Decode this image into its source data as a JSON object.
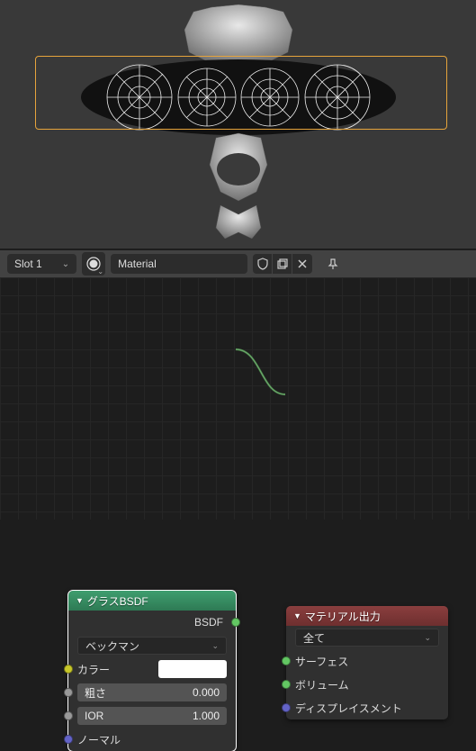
{
  "header": {
    "slot_label": "Slot 1",
    "material_name": "Material"
  },
  "glass_node": {
    "title": "グラスBSDF",
    "output_label": "BSDF",
    "distribution": "ベックマン",
    "color_label": "カラー",
    "color_value": "#ffffff",
    "roughness_label": "粗さ",
    "roughness_value": "0.000",
    "ior_label": "IOR",
    "ior_value": "1.000",
    "normal_label": "ノーマル"
  },
  "output_node": {
    "title": "マテリアル出力",
    "target": "全て",
    "surface_label": "サーフェス",
    "volume_label": "ボリューム",
    "displacement_label": "ディスプレイスメント"
  }
}
